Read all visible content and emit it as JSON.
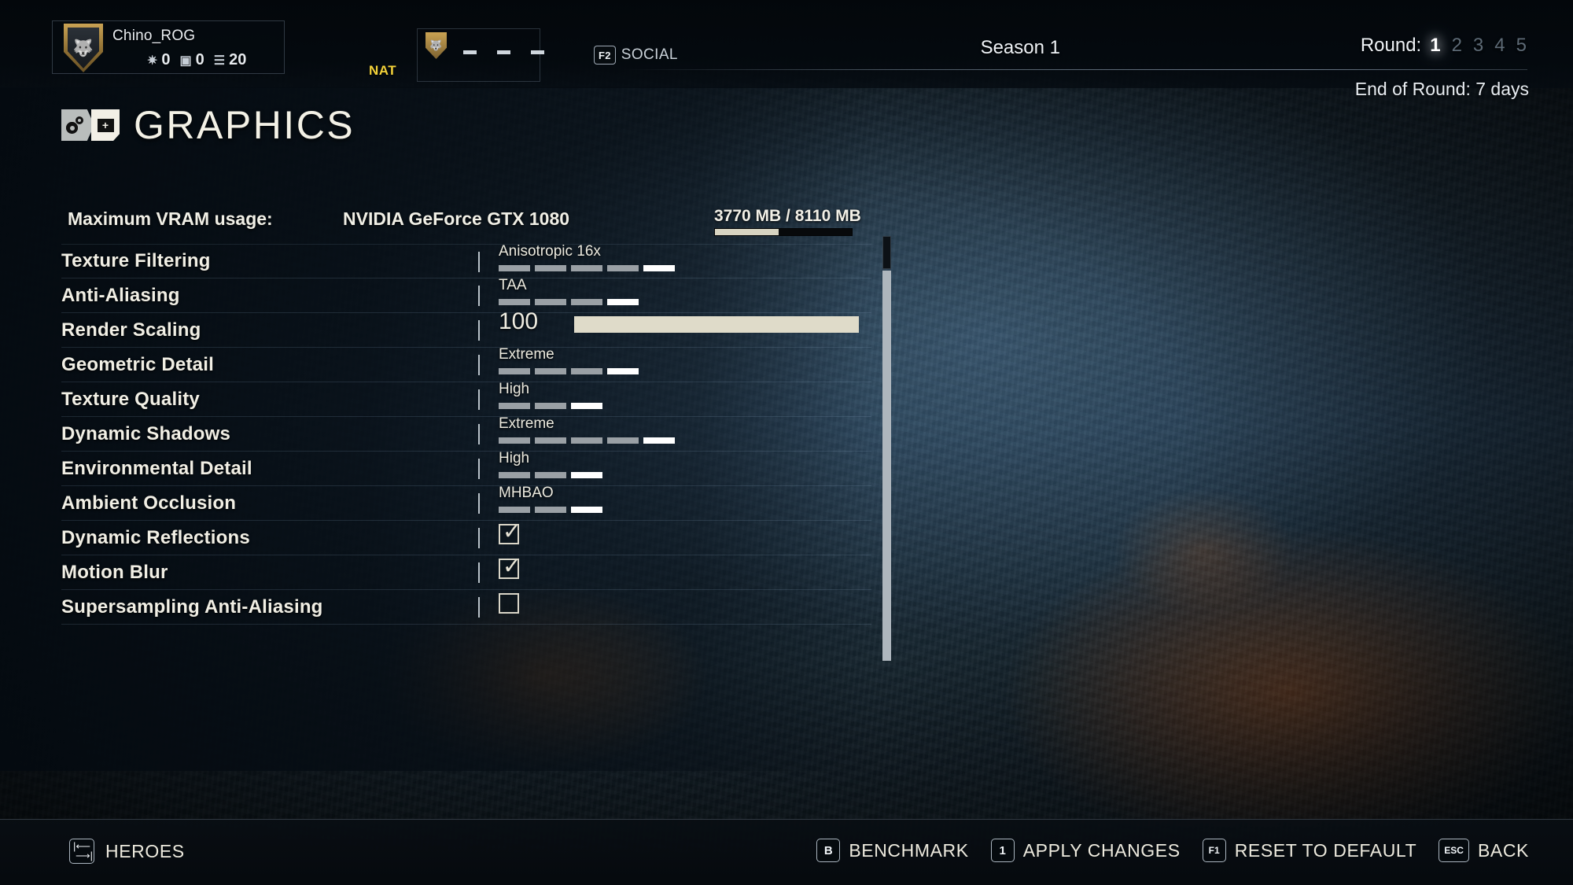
{
  "header": {
    "player": {
      "name": "Chino_ROG",
      "shield_icon": "wolf-crest-icon",
      "stats": [
        {
          "icon": "renown-icon",
          "glyph": "✷",
          "value": "0"
        },
        {
          "icon": "credits-icon",
          "glyph": "▣",
          "value": "0"
        },
        {
          "icon": "level-icon",
          "glyph": "☰",
          "value": "20"
        }
      ]
    },
    "nat_label": "NAT",
    "squad": {
      "shield_icon": "squad-crest-icon",
      "slots": [
        "-",
        "-",
        "-"
      ]
    },
    "social": {
      "key": "F2",
      "label": "SOCIAL"
    },
    "season": "Season 1",
    "round": {
      "label": "Round:",
      "numbers": [
        "1",
        "2",
        "3",
        "4",
        "5"
      ],
      "active_index": 0
    },
    "end_of_round": "End of Round: 7 days"
  },
  "page": {
    "title": "GRAPHICS",
    "title_icon": "graphics-settings-icon"
  },
  "vram": {
    "label": "Maximum VRAM usage:",
    "gpu": "NVIDIA GeForce GTX 1080",
    "used_text": "3770 MB / 8110 MB",
    "used_mb": 3770,
    "total_mb": 8110,
    "fill_percent": 46.5,
    "fill_color": "#d8d4c2"
  },
  "settings": [
    {
      "name": "texture-filtering",
      "label": "Texture Filtering",
      "type": "segments",
      "value": "Anisotropic 16x",
      "segments": 5,
      "active": 5
    },
    {
      "name": "anti-aliasing",
      "label": "Anti-Aliasing",
      "type": "segments",
      "value": "TAA",
      "segments": 4,
      "active": 4
    },
    {
      "name": "render-scaling",
      "label": "Render Scaling",
      "type": "slider",
      "value": "100",
      "fill_percent": 100
    },
    {
      "name": "geometric-detail",
      "label": "Geometric Detail",
      "type": "segments",
      "value": "Extreme",
      "segments": 4,
      "active": 4
    },
    {
      "name": "texture-quality",
      "label": "Texture Quality",
      "type": "segments",
      "value": "High",
      "segments": 3,
      "active": 3
    },
    {
      "name": "dynamic-shadows",
      "label": "Dynamic Shadows",
      "type": "segments",
      "value": "Extreme",
      "segments": 5,
      "active": 5
    },
    {
      "name": "environmental-detail",
      "label": "Environmental Detail",
      "type": "segments",
      "value": "High",
      "segments": 3,
      "active": 3
    },
    {
      "name": "ambient-occlusion",
      "label": "Ambient Occlusion",
      "type": "segments",
      "value": "MHBAO",
      "segments": 3,
      "active": 3
    },
    {
      "name": "dynamic-reflections",
      "label": "Dynamic Reflections",
      "type": "checkbox",
      "checked": true
    },
    {
      "name": "motion-blur",
      "label": "Motion Blur",
      "type": "checkbox",
      "checked": true
    },
    {
      "name": "supersampling-anti-aliasing",
      "label": "Supersampling Anti-Aliasing",
      "type": "checkbox",
      "checked": false
    }
  ],
  "footer": {
    "left": {
      "icon": "tab-switch-icon",
      "label": "HEROES"
    },
    "actions": [
      {
        "name": "benchmark",
        "key": "B",
        "label": "BENCHMARK"
      },
      {
        "name": "apply-changes",
        "key": "1",
        "label": "APPLY CHANGES"
      },
      {
        "name": "reset-to-default",
        "key": "F1",
        "label": "RESET TO DEFAULT"
      },
      {
        "name": "back",
        "key": "ESC",
        "label": "BACK"
      }
    ]
  }
}
